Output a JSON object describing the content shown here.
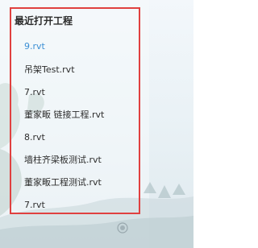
{
  "recent_projects": {
    "title": "最近打开工程",
    "items": [
      {
        "label": "9.rvt",
        "state": "active"
      },
      {
        "label": "吊架Test.rvt"
      },
      {
        "label": "7.rvt"
      },
      {
        "label": "董家畈 链接工程.rvt"
      },
      {
        "label": "8.rvt"
      },
      {
        "label": "墙柱齐梁板测试.rvt"
      },
      {
        "label": "董家畈工程测试.rvt"
      },
      {
        "label": "7.rvt"
      }
    ]
  },
  "colors": {
    "highlight_border": "#e0403f",
    "active_item": "#3b8fd4",
    "text": "#2e2e2e"
  }
}
